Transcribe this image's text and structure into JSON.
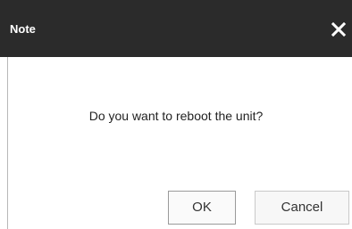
{
  "dialog": {
    "title": "Note",
    "message": "Do you want to reboot the unit?",
    "close_icon": "close-icon",
    "buttons": {
      "ok_label": "OK",
      "cancel_label": "Cancel"
    }
  },
  "colors": {
    "titlebar_bg": "#2b2b2b",
    "title_text": "#ffffff",
    "body_bg": "#ffffff"
  }
}
